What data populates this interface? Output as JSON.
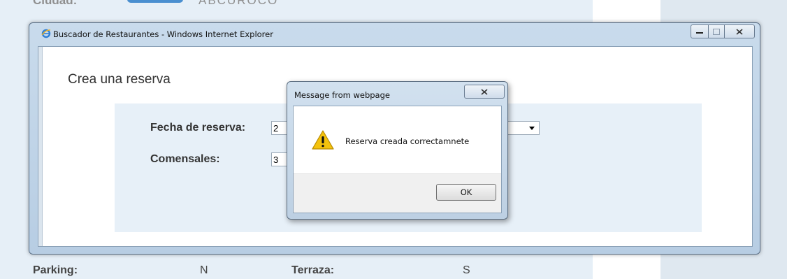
{
  "background": {
    "top_label": "Ciudad:",
    "top_value": "ABCUROCO",
    "bottom_row": {
      "parking_label": "Parking:",
      "parking_value": "N",
      "terraza_label": "Terraza:",
      "terraza_value": "S"
    }
  },
  "window": {
    "title": "Buscador de Restaurantes - Windows Internet Explorer",
    "icon": "ie-logo-icon"
  },
  "page": {
    "heading": "Crea una reserva",
    "form": {
      "fecha_label": "Fecha de reserva:",
      "fecha_value": "2",
      "comensales_label": "Comensales:",
      "comensales_value": "3"
    }
  },
  "dialog": {
    "title": "Message from webpage",
    "message": "Reserva creada correctamnete",
    "ok_label": "OK",
    "icon": "warning-icon"
  },
  "colors": {
    "panel_bg": "#e7f0f8",
    "window_frame": "#b7cde3"
  }
}
